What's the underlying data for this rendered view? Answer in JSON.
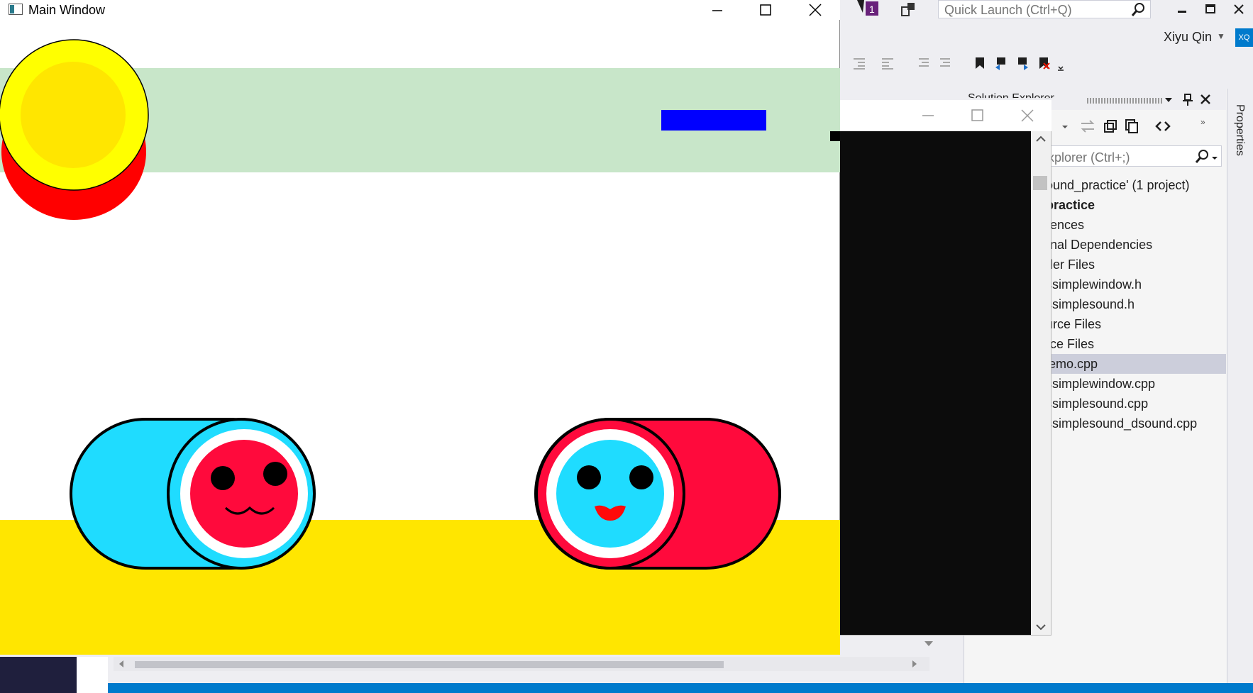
{
  "main_window": {
    "title": "Main Window",
    "icon": "app-window-icon",
    "controls": [
      "minimize-icon",
      "maximize-icon",
      "close-icon"
    ]
  },
  "game": {
    "colors": {
      "track_band": "#c8e6c9",
      "note_blue": "#0000ff",
      "hit_circle_outer": "#ffff00",
      "hit_circle_inner": "#ffe600",
      "hit_circle_shadow": "#ff0000",
      "floor": "#ffe600",
      "drum_cyan": "#1fdcff",
      "drum_red": "#ff0a3c",
      "outline": "#000000"
    },
    "drums": [
      {
        "name": "left-drum",
        "body_color": "cyan",
        "face_color": "red"
      },
      {
        "name": "right-drum",
        "body_color": "red",
        "face_color": "cyan"
      }
    ]
  },
  "console_window": {
    "controls": [
      "minimize-icon",
      "maximize-icon",
      "close-icon"
    ]
  },
  "visual_studio": {
    "notification_count": "1",
    "quick_launch_placeholder": "Quick Launch (Ctrl+Q)",
    "user_name": "Xiyu Qin",
    "user_initials": "XQ",
    "solution_explorer": {
      "title": "Solution Explorer",
      "search_placeholder": "Explorer (Ctrl+;)",
      "items": [
        {
          "label": "ound_practice' (1 project)",
          "bold": false,
          "selected": false
        },
        {
          "label": "practice",
          "bold": true,
          "selected": false
        },
        {
          "label": "rences",
          "bold": false,
          "selected": false
        },
        {
          "label": "rnal Dependencies",
          "bold": false,
          "selected": false
        },
        {
          "label": "der Files",
          "bold": false,
          "selected": false
        },
        {
          "label": "ssimplewindow.h",
          "bold": false,
          "selected": false
        },
        {
          "label": "ssimplesound.h",
          "bold": false,
          "selected": false
        },
        {
          "label": "urce Files",
          "bold": false,
          "selected": false
        },
        {
          "label": "rce Files",
          "bold": false,
          "selected": false
        },
        {
          "label": "lemo.cpp",
          "bold": false,
          "selected": true
        },
        {
          "label": "ssimplewindow.cpp",
          "bold": false,
          "selected": false
        },
        {
          "label": "ssimplesound.cpp",
          "bold": false,
          "selected": false
        },
        {
          "label": "ssimplesound_dsound.cpp",
          "bold": false,
          "selected": false
        }
      ]
    },
    "properties_tab": "Properties"
  }
}
